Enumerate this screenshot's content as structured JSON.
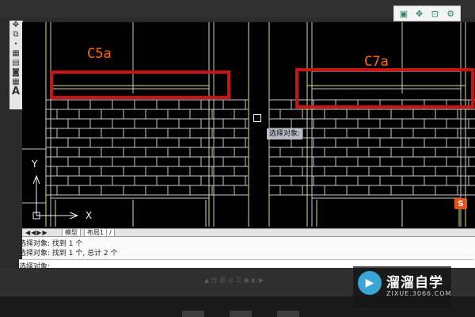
{
  "colors": {
    "background": "#000000",
    "brick_lines": "#c8c8c8",
    "frame_lines": "#e3e36b",
    "highlight": "#c81414",
    "label_orange": "#ff6a00"
  },
  "left_toolbar": {
    "icons": [
      "move-icon",
      "copy-icon",
      "point-icon",
      "block-icon",
      "insert-icon",
      "image-icon",
      "table-icon",
      "text-icon"
    ],
    "glyphs": [
      "✥",
      "⧉",
      "•",
      "▦",
      "▤",
      "◙",
      "▦",
      "A"
    ]
  },
  "right_tools": {
    "icons": [
      "window-restore-icon",
      "fullscreen-icon",
      "save-icon",
      "settings-icon"
    ],
    "glyphs": [
      "▣",
      "✥",
      "⊡",
      "⚙"
    ]
  },
  "drawing": {
    "label_left": "C5a",
    "label_right": "C7a",
    "tooltip": "选择对象:",
    "ucs_y": "Y",
    "ucs_x": "X"
  },
  "layout_tabs": {
    "nav": "◀◀▶▶",
    "model": "模型",
    "layout1": "布局1",
    "extra": "/"
  },
  "command_line": {
    "history": [
      "选择对象: 找到 1 个",
      "选择对象: 找到 1 个, 总计 2 个"
    ],
    "prompt": "选择对象:"
  },
  "status_bar": {
    "faint_text": "▲ 分 国   ◎ 工 ◉ ◐ ▶"
  },
  "watermark": {
    "title": "溜溜自学",
    "url": "ZIXUE.3066.COM",
    "logo_glyph": "▶"
  },
  "app_logo": {
    "glyph": "S"
  }
}
